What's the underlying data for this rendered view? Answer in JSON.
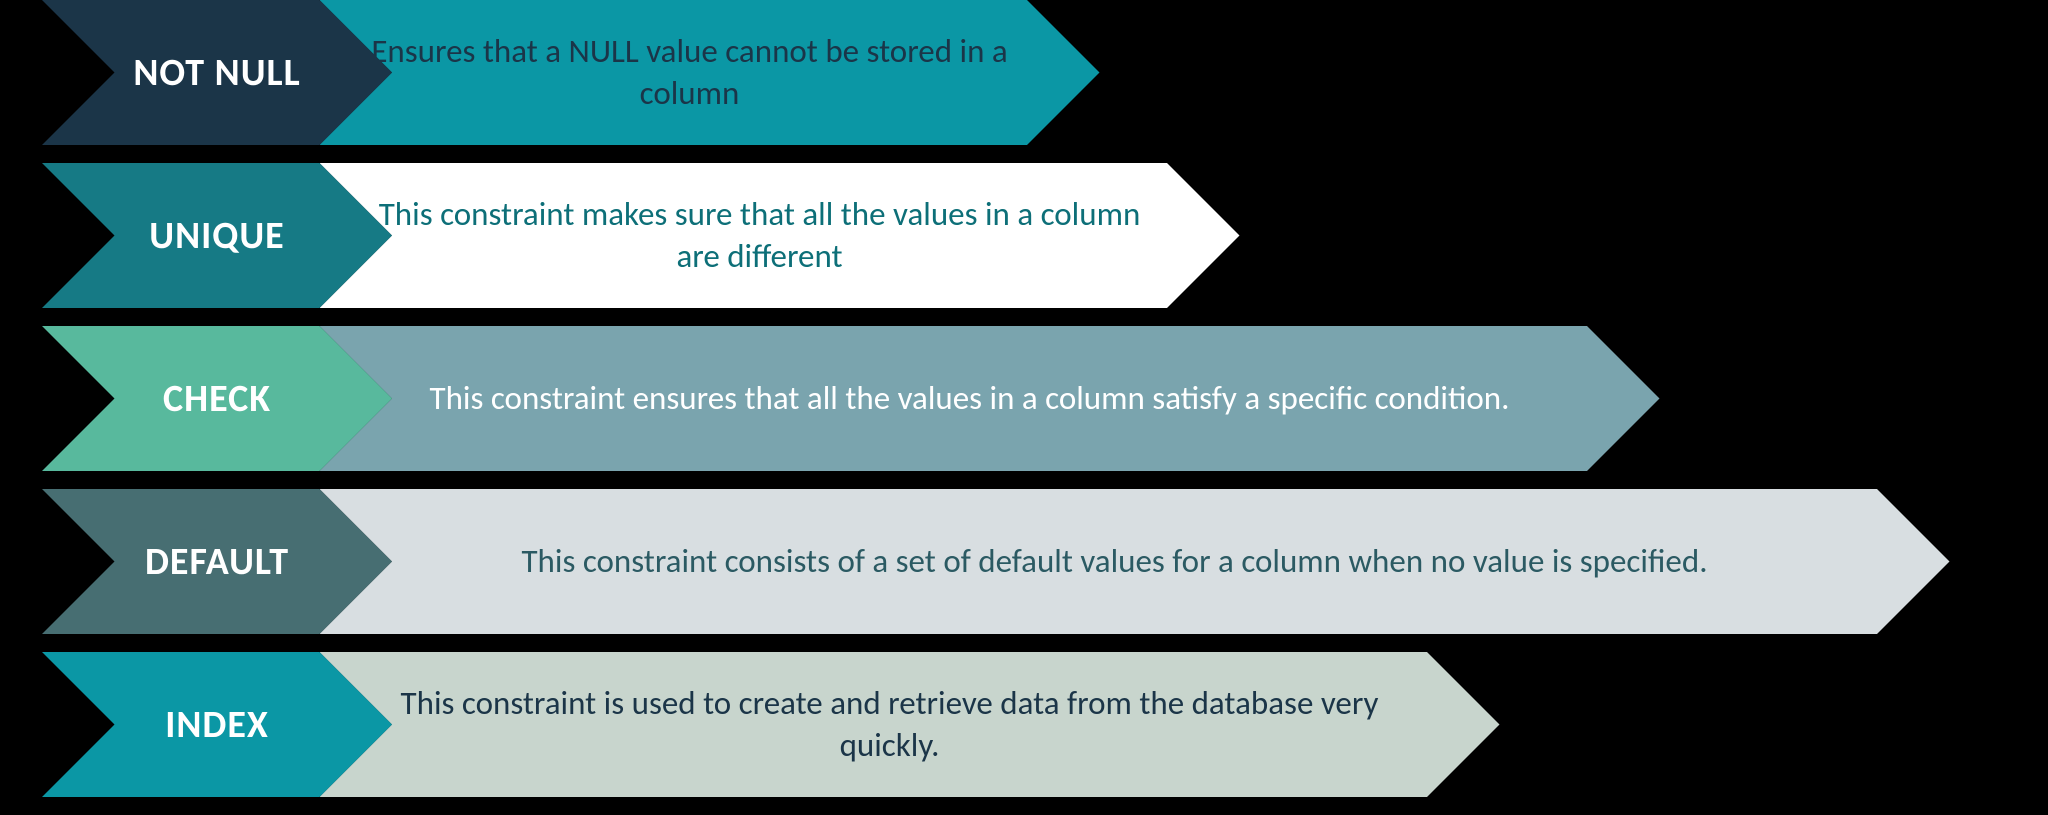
{
  "rows": [
    {
      "label": "NOT NULL",
      "desc": "Ensures that a NULL value cannot be stored in a column",
      "labelFill": "#1b3548",
      "descFill": "#0b97a5",
      "descText": "#1b3548",
      "descWidth": 780
    },
    {
      "label": "UNIQUE",
      "desc": "This constraint makes sure that all the values in a column are different",
      "labelFill": "#167a85",
      "descFill": "#ffffff",
      "descText": "#0d6f78",
      "descWidth": 920
    },
    {
      "label": "CHECK",
      "desc": "This constraint ensures that all the values in a column satisfy a specific condition.",
      "labelFill": "#58b99d",
      "descFill": "#7aa4ae",
      "descText": "#ffffff",
      "descWidth": 1340
    },
    {
      "label": "DEFAULT",
      "desc": "This constraint consists of a set of default values for a column when no value is specified.",
      "labelFill": "#476e72",
      "descFill": "#d8dee1",
      "descText": "#2b5a63",
      "descWidth": 1630
    },
    {
      "label": "INDEX",
      "desc": "This constraint is used to create and retrieve data from the database very quickly.",
      "labelFill": "#0b97a5",
      "descFill": "#c8d5cd",
      "descText": "#1b3548",
      "descWidth": 1180
    }
  ]
}
